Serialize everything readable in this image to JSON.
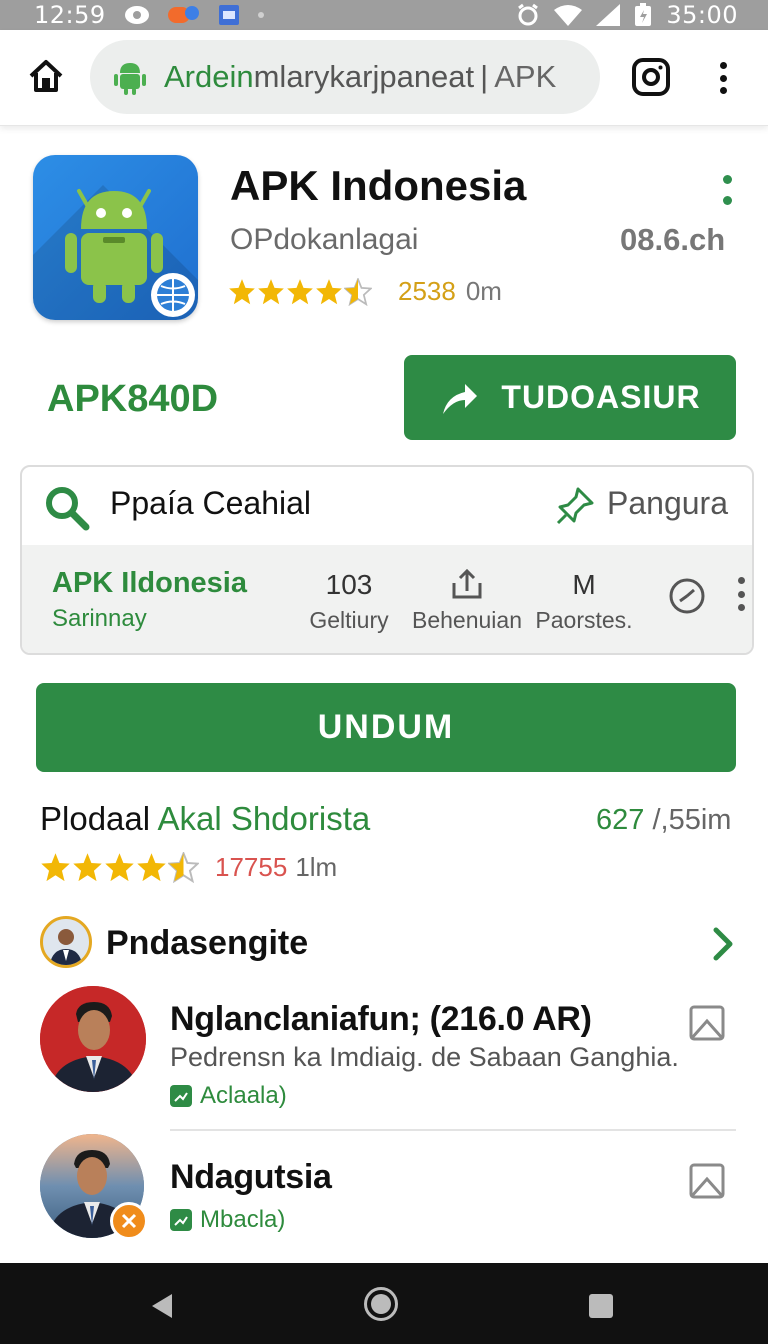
{
  "status_bar": {
    "time": "12:59",
    "right_time": "35:00",
    "icons": [
      "eye-icon",
      "notification-icon",
      "calendar-icon",
      "alarm-icon",
      "wifi-icon",
      "signal-icon",
      "battery-icon"
    ]
  },
  "browser": {
    "url_green": "Ardein",
    "url_gray": "mlarykarjpaneat",
    "url_sep": "|",
    "url_tail": "APK",
    "icons": [
      "home-icon",
      "android-icon",
      "instagram-icon",
      "more-vert-icon"
    ]
  },
  "app": {
    "title": "APK Indonesia",
    "developer": "OPdokanlagai",
    "size": "08.6.ch",
    "rating_stars": 4.5,
    "rating_count": "2538",
    "rating_unit": "0m",
    "code": "APK840D",
    "primary_button": "TUDOASIUR"
  },
  "search_card": {
    "query": "Ppaía Ceahial",
    "pin_label": "Pangura",
    "info_title": "APK Ildonesia",
    "info_sub": "Sarinnay",
    "stats": [
      {
        "value": "103",
        "label": "Geltiury"
      },
      {
        "value": "",
        "label": "Behenuian"
      },
      {
        "value": "M",
        "label": "Paorstes."
      }
    ]
  },
  "download_button": "UNDUM",
  "product": {
    "title_black": "Plodaal",
    "title_green": "Akal Shdorista",
    "size_green": "627",
    "size_gray": "/,55im",
    "rating_stars": 4.5,
    "rating_count": "17755",
    "rating_unit": "1lm"
  },
  "section": {
    "title": "Pndasengite"
  },
  "items": [
    {
      "title": "Nglanclaniafun; (216.0 AR)",
      "description": "Pedrensn ka Imdiaig. de Sabaan Ganghia.",
      "tag": "Aclaala)"
    },
    {
      "title": "Ndagutsia",
      "tag": "Mbacla)"
    }
  ],
  "colors": {
    "accent_green": "#2e8b45",
    "text_green": "#2e8b3d",
    "star_yellow": "#f2b705",
    "status_bar": "#9e9e9e",
    "nav_bar": "#111111"
  }
}
